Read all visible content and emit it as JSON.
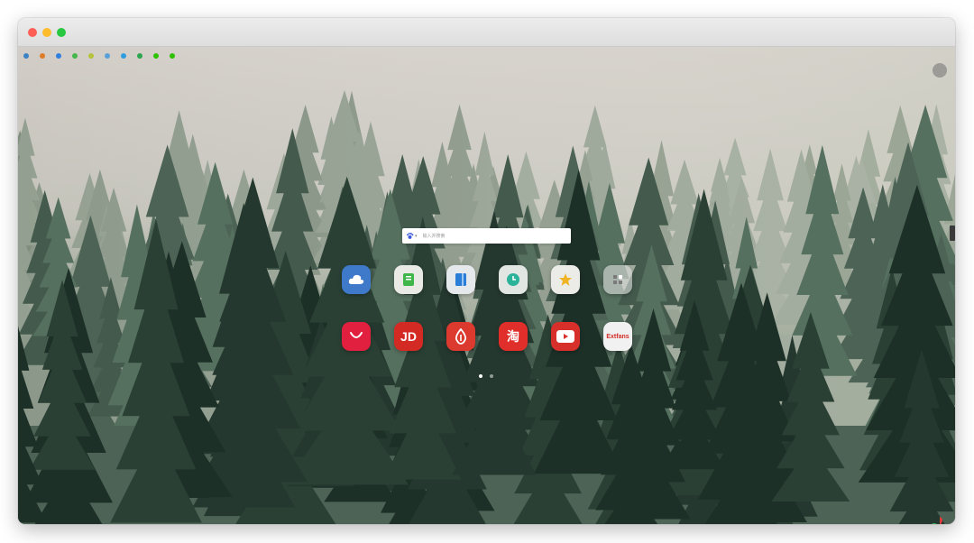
{
  "window": {
    "traffic_lights": {
      "close": "#fd5f57",
      "minimize": "#fdbc2e",
      "zoom": "#28c840"
    }
  },
  "bookmarks": [
    {
      "label": "",
      "icon": "globe-icon",
      "color": "#3b82c4"
    },
    {
      "label": "",
      "icon": "fire-icon",
      "color": "#e07b28"
    },
    {
      "label": "",
      "icon": "circle-icon",
      "color": "#2f7fe0"
    },
    {
      "label": "",
      "icon": "leaf-icon",
      "color": "#45b649"
    },
    {
      "label": "",
      "icon": "leaf-icon",
      "color": "#b5c23a"
    },
    {
      "label": "",
      "icon": "cloud-icon",
      "color": "#5aa0d8"
    },
    {
      "label": "",
      "icon": "circle-icon",
      "color": "#2f9ee0"
    },
    {
      "label": "",
      "icon": "circle-icon",
      "color": "#2ea44f"
    },
    {
      "label": "",
      "icon": "wechat-icon",
      "color": "#2dc100"
    },
    {
      "label": "",
      "icon": "wechat-icon",
      "color": "#2dc100"
    }
  ],
  "top_right_button": {
    "label": "",
    "icon": "toggle-icon"
  },
  "search": {
    "engine_tabs": [],
    "placeholder": "输入并搜索",
    "engine_icon": "paw-icon"
  },
  "apps_row1": [
    {
      "label": "",
      "icon": "cloud-icon",
      "bg": "#3f79c9",
      "fg": "#ffffff"
    },
    {
      "label": "",
      "icon": "notebook-icon",
      "bg": "#e9eae6",
      "fg": "#3fb64a"
    },
    {
      "label": "",
      "icon": "book-icon",
      "bg": "#e6e9ec",
      "fg": "#2a7ed8"
    },
    {
      "label": "",
      "icon": "clock-icon",
      "bg": "#e2e6e3",
      "fg": "#2bb39a"
    },
    {
      "label": "",
      "icon": "star-icon",
      "bg": "#ebebe8",
      "fg": "#f0b323"
    },
    {
      "label": "",
      "icon": "add-icon",
      "bg": "rgba(225,225,225,0.6)",
      "fg": "#7a7a7a"
    }
  ],
  "apps_row2": [
    {
      "label": "",
      "icon": "smile-bag-icon",
      "bg": "#e0203e",
      "fg": "#ffffff"
    },
    {
      "label": "",
      "icon": "jd-icon",
      "text": "JD",
      "bg": "#d42a24",
      "fg": "#ffffff"
    },
    {
      "label": "",
      "icon": "drop-icon",
      "bg": "#dc3a2e",
      "fg": "#ffffff"
    },
    {
      "label": "",
      "icon": "taobao-icon",
      "text": "淘",
      "bg": "#e02f2a",
      "fg": "#ffffff"
    },
    {
      "label": "",
      "icon": "youtube-icon",
      "bg": "#d7302a",
      "fg": "#ffffff"
    },
    {
      "label": "",
      "icon": "extfans-icon",
      "text": "Extfans",
      "bg": "#f1f1f1",
      "fg": "#d12b25"
    }
  ],
  "pagination": {
    "pages": 2,
    "current": 1
  }
}
